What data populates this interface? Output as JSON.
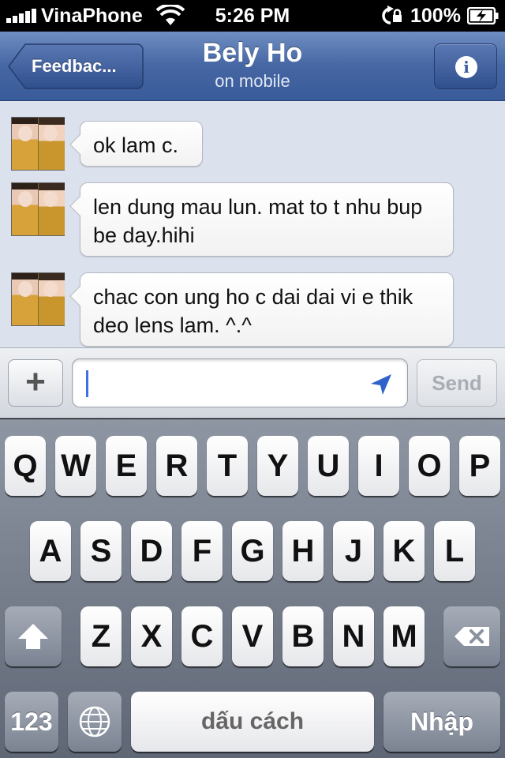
{
  "status_bar": {
    "carrier": "VinaPhone",
    "time": "5:26 PM",
    "battery": "100%"
  },
  "nav": {
    "back_label": "Feedbac...",
    "title": "Bely Ho",
    "subtitle": "on mobile",
    "info_label": "i"
  },
  "messages": [
    {
      "text": "ok lam c."
    },
    {
      "text": "len dung mau lun. mat to t nhu bup be day.hihi"
    },
    {
      "text": "chac con ung ho c dai dai vi e thik deo lens lam. ^.^"
    }
  ],
  "composer": {
    "plus_label": "+",
    "input_value": "",
    "send_label": "Send"
  },
  "keyboard": {
    "row1": [
      "Q",
      "W",
      "E",
      "R",
      "T",
      "Y",
      "U",
      "I",
      "O",
      "P"
    ],
    "row2": [
      "A",
      "S",
      "D",
      "F",
      "G",
      "H",
      "J",
      "K",
      "L"
    ],
    "row3": [
      "Z",
      "X",
      "C",
      "V",
      "B",
      "N",
      "M"
    ],
    "numbers_label": "123",
    "space_label": "dấu cách",
    "return_label": "Nhập"
  }
}
